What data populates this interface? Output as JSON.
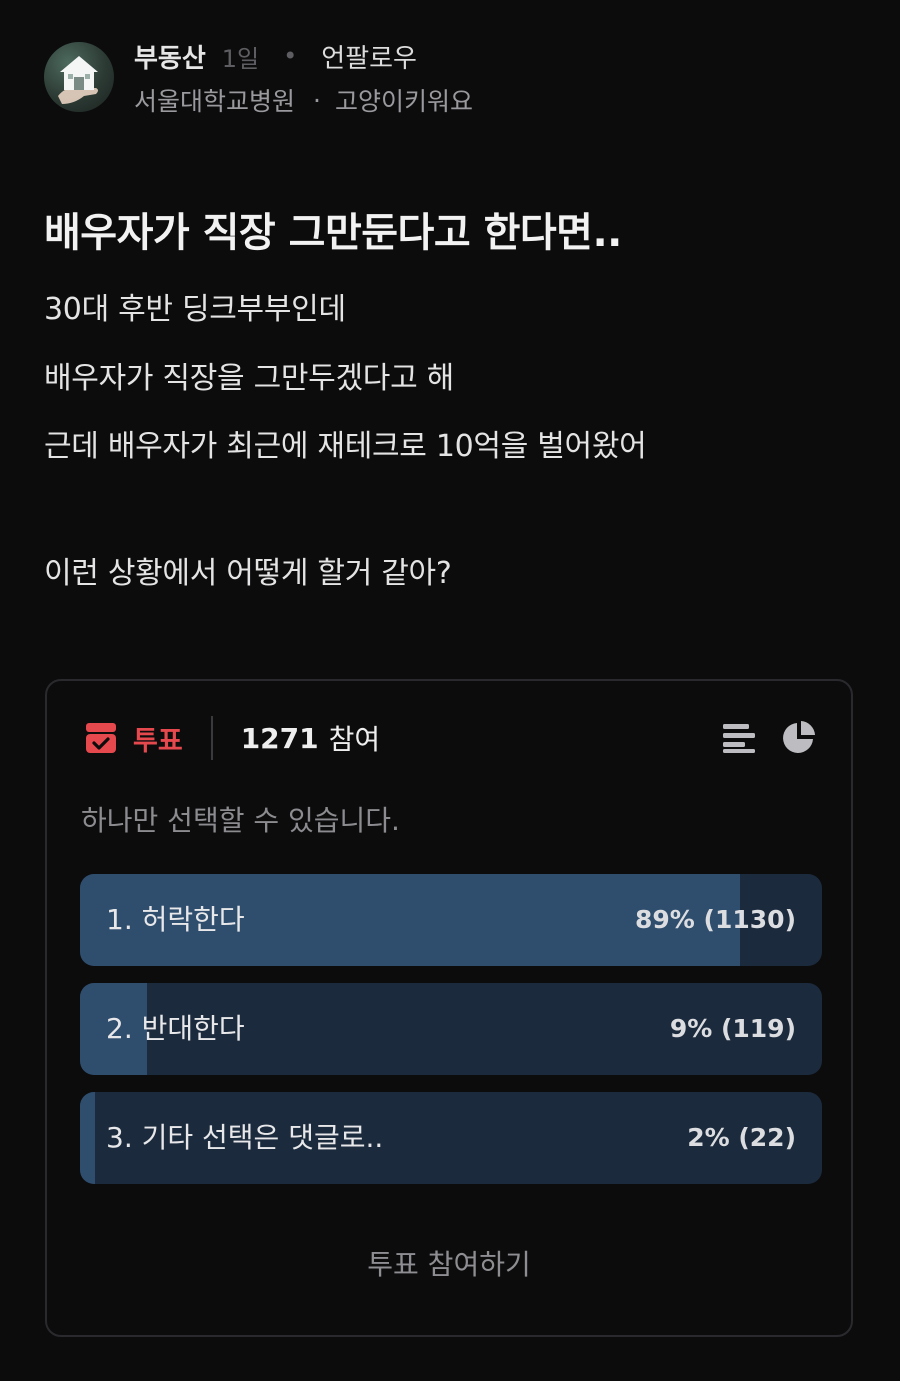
{
  "post": {
    "author": "부동산",
    "time": "1일",
    "follow_label": "언팔로우",
    "affiliation": "서울대학교병원",
    "tag": "고양이키워요",
    "title": "배우자가 직장 그만둔다고 한다면..",
    "body_lines": [
      "30대 후반 딩크부부인데",
      "배우자가 직장을 그만두겠다고 해",
      "근데 배우자가 최근에 재테크로 10억을 벌어왔어",
      "이런 상황에서 어떻게 할거 같아?"
    ]
  },
  "poll": {
    "label": "투표",
    "participants": "1271",
    "participants_suffix": "참여",
    "note": "하나만 선택할 수 있습니다.",
    "options": [
      {
        "label": "1. 허락한다",
        "result": "89% (1130)",
        "percent": 89
      },
      {
        "label": "2. 반대한다",
        "result": "9% (119)",
        "percent": 9
      },
      {
        "label": "3. 기타 선택은 댓글로..",
        "result": "2% (22)",
        "percent": 2
      }
    ],
    "vote_button": "투표 참여하기",
    "icons": {
      "poll": "ballot-box-icon",
      "list_view": "bar-list-icon",
      "chart_view": "pie-chart-icon"
    },
    "colors": {
      "accent": "#e5484d",
      "option_bg": "#1b2a3d",
      "option_fill": "#2f4d6d"
    }
  }
}
